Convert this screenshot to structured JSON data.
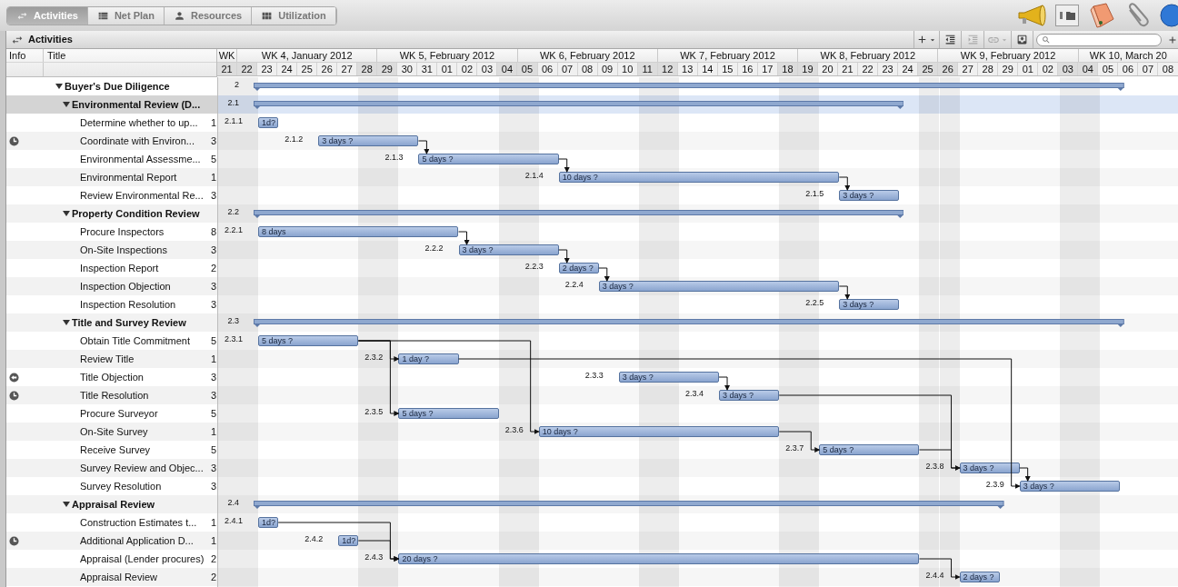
{
  "tabs": [
    {
      "label": "Activities",
      "selected": true
    },
    {
      "label": "Net Plan",
      "selected": false
    },
    {
      "label": "Resources",
      "selected": false
    },
    {
      "label": "Utilization",
      "selected": false
    }
  ],
  "panel": {
    "title": "Activities"
  },
  "columns": {
    "info": "Info",
    "title": "Title"
  },
  "timeline": {
    "weeks": [
      {
        "label": "WK",
        "days": [
          {
            "label": "21",
            "weekend": true
          }
        ]
      },
      {
        "label": "WK 4, January 2012",
        "days": [
          {
            "label": "22",
            "weekend": true
          },
          {
            "label": "23",
            "weekend": false
          },
          {
            "label": "24",
            "weekend": false
          },
          {
            "label": "25",
            "weekend": false
          },
          {
            "label": "26",
            "weekend": false
          },
          {
            "label": "27",
            "weekend": false
          },
          {
            "label": "28",
            "weekend": true
          }
        ]
      },
      {
        "label": "WK 5, February 2012",
        "days": [
          {
            "label": "29",
            "weekend": true
          },
          {
            "label": "30",
            "weekend": false
          },
          {
            "label": "31",
            "weekend": false
          },
          {
            "label": "01",
            "weekend": false
          },
          {
            "label": "02",
            "weekend": false
          },
          {
            "label": "03",
            "weekend": false
          },
          {
            "label": "04",
            "weekend": true
          }
        ]
      },
      {
        "label": "WK 6, February 2012",
        "days": [
          {
            "label": "05",
            "weekend": true
          },
          {
            "label": "06",
            "weekend": false
          },
          {
            "label": "07",
            "weekend": false
          },
          {
            "label": "08",
            "weekend": false
          },
          {
            "label": "09",
            "weekend": false
          },
          {
            "label": "10",
            "weekend": false
          },
          {
            "label": "11",
            "weekend": true
          }
        ]
      },
      {
        "label": "WK 7, February 2012",
        "days": [
          {
            "label": "12",
            "weekend": true
          },
          {
            "label": "13",
            "weekend": false
          },
          {
            "label": "14",
            "weekend": false
          },
          {
            "label": "15",
            "weekend": false
          },
          {
            "label": "16",
            "weekend": false
          },
          {
            "label": "17",
            "weekend": false
          },
          {
            "label": "18",
            "weekend": true
          }
        ]
      },
      {
        "label": "WK 8, February 2012",
        "days": [
          {
            "label": "19",
            "weekend": true
          },
          {
            "label": "20",
            "weekend": false
          },
          {
            "label": "21",
            "weekend": false
          },
          {
            "label": "22",
            "weekend": false
          },
          {
            "label": "23",
            "weekend": false
          },
          {
            "label": "24",
            "weekend": false
          },
          {
            "label": "25",
            "weekend": true
          }
        ]
      },
      {
        "label": "WK 9, February 2012",
        "days": [
          {
            "label": "26",
            "weekend": true
          },
          {
            "label": "27",
            "weekend": false
          },
          {
            "label": "28",
            "weekend": false
          },
          {
            "label": "29",
            "weekend": false
          },
          {
            "label": "01",
            "weekend": false
          },
          {
            "label": "02",
            "weekend": false
          },
          {
            "label": "03",
            "weekend": true
          }
        ]
      },
      {
        "label": "WK 10, March 20",
        "days": [
          {
            "label": "04",
            "weekend": true
          },
          {
            "label": "05",
            "weekend": false
          },
          {
            "label": "06",
            "weekend": false
          },
          {
            "label": "07",
            "weekend": false
          },
          {
            "label": "08",
            "weekend": false
          }
        ]
      }
    ]
  },
  "activities": [
    {
      "title": "Buyer's Due Diligence",
      "wbs": "2",
      "expanded": true,
      "selected": false,
      "children": [
        {
          "title": "Environmental Review (D...",
          "wbs": "2.1",
          "expanded": true,
          "selected": true,
          "children": [
            {
              "title": "Determine whether to up...",
              "duration": "1",
              "wbs": "2.1.1",
              "selected": false,
              "kind": "task",
              "bar_label": "1d?"
            },
            {
              "title": "Coordinate with Environ...",
              "duration": "3",
              "wbs": "2.1.2",
              "selected": false,
              "kind": "clock-task",
              "bar_label": "3 days ?"
            },
            {
              "title": "Environmental Assessme...",
              "duration": "5",
              "wbs": "2.1.3",
              "selected": false,
              "kind": "task",
              "bar_label": "5 days ?"
            },
            {
              "title": "Environmental Report",
              "duration": "1",
              "wbs": "2.1.4",
              "selected": false,
              "kind": "task",
              "bar_label": "10 days ?"
            },
            {
              "title": "Review Environmental Re...",
              "duration": "3",
              "wbs": "2.1.5",
              "selected": false,
              "kind": "task",
              "bar_label": "3 days ?"
            }
          ]
        },
        {
          "title": "Property Condition Review",
          "wbs": "2.2",
          "expanded": true,
          "selected": false,
          "children": [
            {
              "title": "Procure Inspectors",
              "duration": "8",
              "wbs": "2.2.1",
              "selected": false,
              "kind": "task",
              "bar_label": "8 days"
            },
            {
              "title": "On-Site Inspections",
              "duration": "3",
              "wbs": "2.2.2",
              "selected": false,
              "kind": "task",
              "bar_label": "3 days ?"
            },
            {
              "title": "Inspection Report",
              "duration": "2",
              "wbs": "2.2.3",
              "selected": false,
              "kind": "task",
              "bar_label": "2 days ?"
            },
            {
              "title": "Inspection Objection",
              "duration": "3",
              "wbs": "2.2.4",
              "selected": false,
              "kind": "task",
              "bar_label": "3 days ?"
            },
            {
              "title": "Inspection Resolution",
              "duration": "3",
              "wbs": "2.2.5",
              "selected": false,
              "kind": "task",
              "bar_label": "3 days ?"
            }
          ]
        },
        {
          "title": "Title and Survey Review",
          "wbs": "2.3",
          "expanded": true,
          "selected": false,
          "children": [
            {
              "title": "Obtain Title Commitment",
              "duration": "5",
              "wbs": "2.3.1",
              "selected": false,
              "kind": "task",
              "bar_label": "5 days ?"
            },
            {
              "title": "Review Title",
              "duration": "1",
              "wbs": "2.3.2",
              "selected": false,
              "kind": "task",
              "bar_label": "1 day ?"
            },
            {
              "title": "Title Objection",
              "duration": "3",
              "wbs": "2.3.3",
              "selected": false,
              "kind": "arrow-task",
              "bar_label": "3 days ?"
            },
            {
              "title": "Title Resolution",
              "duration": "3",
              "wbs": "2.3.4",
              "selected": false,
              "kind": "clock-task",
              "bar_label": "3 days ?"
            },
            {
              "title": "Procure Surveyor",
              "duration": "5",
              "wbs": "2.3.5",
              "selected": false,
              "kind": "task",
              "bar_label": "5 days ?"
            },
            {
              "title": "On-Site Survey",
              "duration": "1",
              "wbs": "2.3.6",
              "selected": false,
              "kind": "task",
              "bar_label": "10 days ?"
            },
            {
              "title": "Receive Survey",
              "duration": "5",
              "wbs": "2.3.7",
              "selected": false,
              "kind": "task",
              "bar_label": "5 days ?"
            },
            {
              "title": "Survey Review and Objec...",
              "duration": "3",
              "wbs": "2.3.8",
              "selected": false,
              "kind": "task",
              "bar_label": "3 days ?"
            },
            {
              "title": "Survey Resolution",
              "duration": "3",
              "wbs": "2.3.9",
              "selected": false,
              "kind": "task",
              "bar_label": "3 days ?"
            }
          ]
        },
        {
          "title": "Appraisal Review",
          "wbs": "2.4",
          "expanded": true,
          "selected": false,
          "children": [
            {
              "title": "Construction Estimates t...",
              "duration": "1",
              "wbs": "2.4.1",
              "selected": false,
              "kind": "task",
              "bar_label": "1d?"
            },
            {
              "title": "Additional Application D...",
              "duration": "1",
              "wbs": "2.4.2",
              "selected": false,
              "kind": "clock-task",
              "bar_label": "1d?"
            },
            {
              "title": "Appraisal (Lender procures)",
              "duration": "2",
              "wbs": "2.4.3",
              "selected": false,
              "kind": "task",
              "bar_label": "20 days ?"
            },
            {
              "title": "Appraisal Review",
              "duration": "2",
              "wbs": "2.4.4",
              "selected": false,
              "kind": "task",
              "bar_label": "2 days ?"
            }
          ]
        }
      ]
    }
  ]
}
